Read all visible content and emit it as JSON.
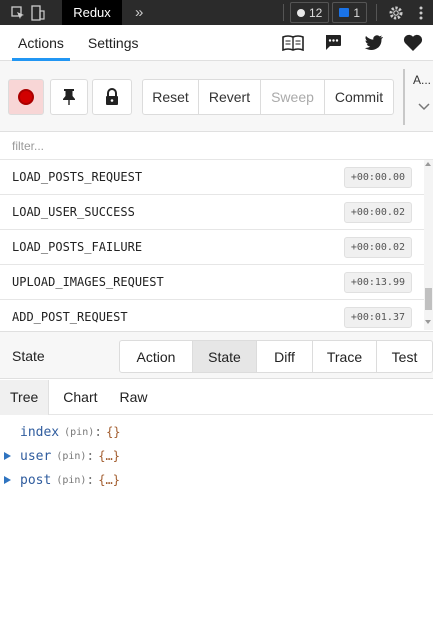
{
  "devtools": {
    "active_tab": "Redux",
    "more_glyph": "»",
    "errors_count": "12",
    "messages_count": "1"
  },
  "toolbar": {
    "tabs": [
      "Actions",
      "Settings"
    ],
    "active_tab": "Actions",
    "right_icons": [
      "book-icon",
      "chat-icon",
      "twitter-icon",
      "heart-icon"
    ]
  },
  "controls": {
    "reset_label": "Reset",
    "revert_label": "Revert",
    "sweep_label": "Sweep",
    "commit_label": "Commit",
    "autoselect_label": "A..."
  },
  "filter": {
    "placeholder": "filter..."
  },
  "actions": [
    {
      "name": "LOAD_POSTS_REQUEST",
      "time": "+00:00.00"
    },
    {
      "name": "LOAD_USER_SUCCESS",
      "time": "+00:00.02"
    },
    {
      "name": "LOAD_POSTS_FAILURE",
      "time": "+00:00.02"
    },
    {
      "name": "UPLOAD_IMAGES_REQUEST",
      "time": "+00:13.99"
    },
    {
      "name": "ADD_POST_REQUEST",
      "time": "+00:01.37"
    }
  ],
  "inspector": {
    "title": "State",
    "mode_tabs": [
      "Action",
      "State",
      "Diff",
      "Trace",
      "Test"
    ],
    "active_mode": "State",
    "view_tabs": [
      "Tree",
      "Chart",
      "Raw"
    ],
    "active_view": "Tree"
  },
  "tree": [
    {
      "key": "index",
      "pin": "(pin)",
      "value": "{}"
    },
    {
      "key": "user",
      "pin": "(pin)",
      "value": "{…}"
    },
    {
      "key": "post",
      "pin": "(pin)",
      "value": "{…}"
    }
  ],
  "colors": {
    "accent": "#2196f3",
    "record": "#d10000",
    "tree_key": "#2f5c9e"
  }
}
